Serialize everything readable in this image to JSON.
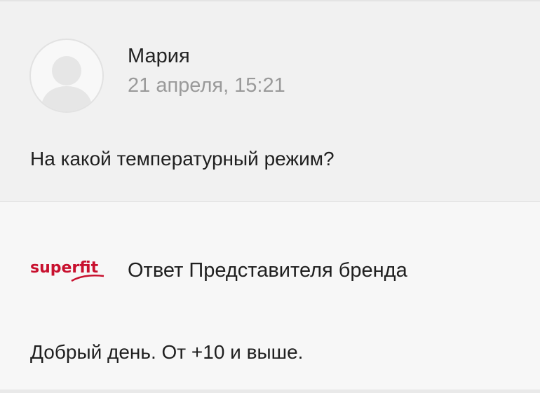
{
  "question": {
    "author_name": "Мария",
    "date": "21 апреля, 15:21",
    "text": "На какой температурный режим?",
    "avatar_icon": "user-silhouette-icon"
  },
  "answer": {
    "brand_logo_text": "superfit",
    "brand_logo_color": "#c8102e",
    "title": "Ответ Представителя бренда",
    "text": "Добрый день. От +10 и выше."
  }
}
